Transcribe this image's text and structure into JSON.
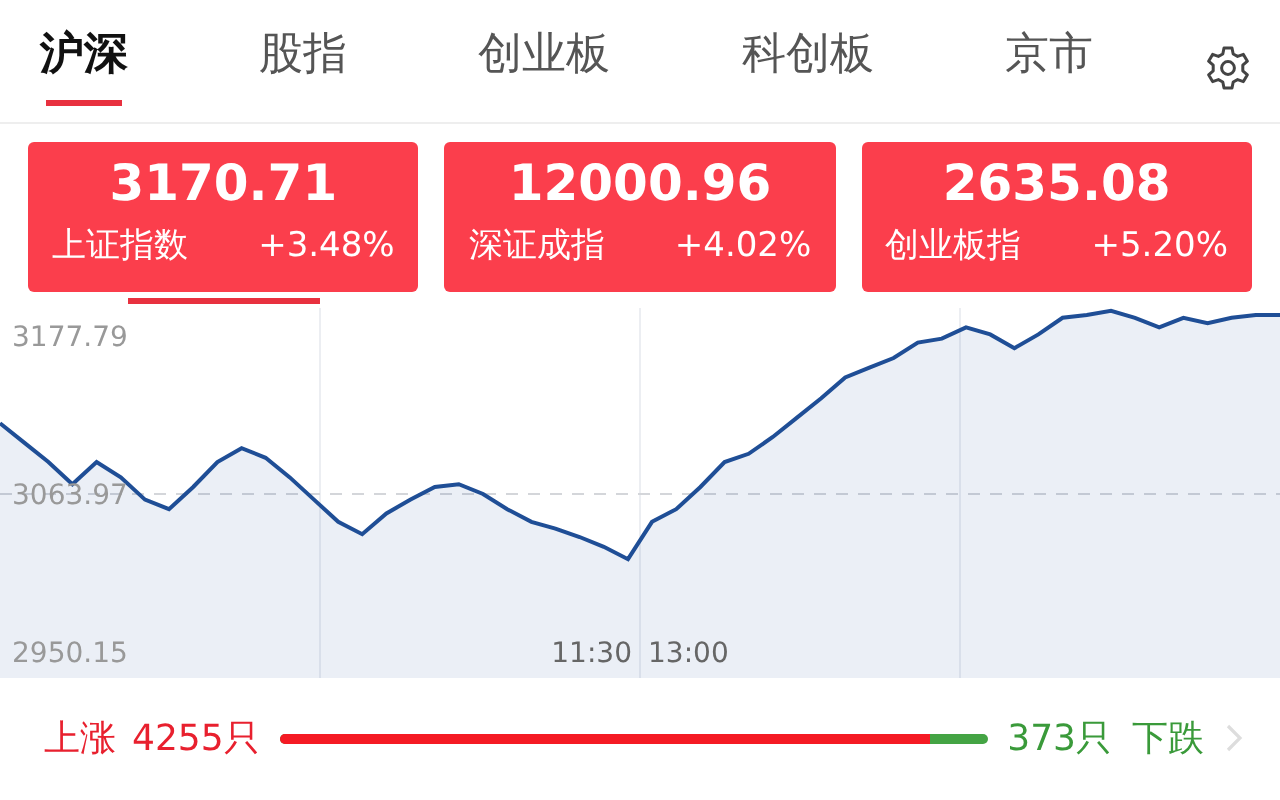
{
  "tabs": [
    {
      "label": "沪深",
      "selected": true
    },
    {
      "label": "股指",
      "selected": false
    },
    {
      "label": "创业板",
      "selected": false
    },
    {
      "label": "科创板",
      "selected": false
    },
    {
      "label": "京市",
      "selected": false
    }
  ],
  "indices": [
    {
      "value": "3170.71",
      "name": "上证指数",
      "change": "+3.48%",
      "selected": true
    },
    {
      "value": "12000.96",
      "name": "深证成指",
      "change": "+4.02%",
      "selected": false
    },
    {
      "value": "2635.08",
      "name": "创业板指",
      "change": "+5.20%",
      "selected": false
    }
  ],
  "chart": {
    "chart_data": {
      "type": "area",
      "ylim": [
        2931.4,
        3198
      ],
      "ref_lines": [
        {
          "axis": "y",
          "value": 3063.97
        }
      ],
      "yticks": [
        2950.15,
        3063.97,
        3177.79
      ],
      "series": [
        {
          "color": "#1f4e96",
          "values": [
            3115,
            3101,
            3087,
            3071,
            3087,
            3076,
            3060,
            3053,
            3069,
            3087,
            3097,
            3090,
            3076,
            3060,
            3044,
            3035,
            3050,
            3060,
            3069,
            3071,
            3064,
            3053,
            3044,
            3039,
            3033,
            3026,
            3017,
            3044,
            3053,
            3069,
            3087,
            3093,
            3105,
            3119,
            3133,
            3148,
            3155,
            3162,
            3173,
            3176,
            3184,
            3179,
            3169,
            3179,
            3191,
            3193,
            3196,
            3191,
            3184,
            3191,
            3187,
            3191,
            3193,
            3193
          ]
        }
      ]
    }
  },
  "time_labels": [
    "11:30",
    "13:00"
  ],
  "breadth": {
    "up_label": "上涨",
    "up_count": "4255只",
    "level": 0.92,
    "down_count": "373只",
    "down_label": "下跌"
  }
}
